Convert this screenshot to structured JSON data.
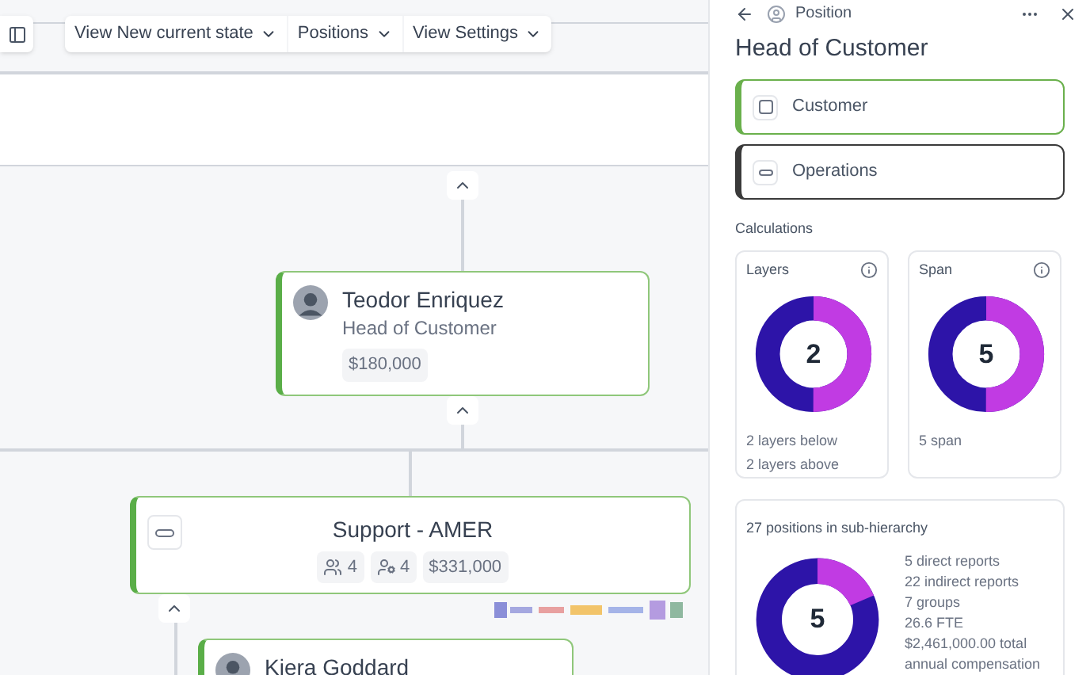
{
  "toolbar": {
    "menus": [
      {
        "label": "View New current state"
      },
      {
        "label": "Positions"
      },
      {
        "label": "View Settings"
      }
    ]
  },
  "org_chart": {
    "nodes": [
      {
        "kind": "person",
        "name": "Teodor Enriquez",
        "title": "Head of Customer",
        "salary": "$180,000"
      },
      {
        "kind": "group",
        "name": "Support - AMER",
        "stats": [
          {
            "kind": "people",
            "value": "4"
          },
          {
            "kind": "positions",
            "value": "4"
          },
          {
            "kind": "money",
            "value": "$331,000"
          }
        ]
      },
      {
        "kind": "person",
        "name": "Kiera Goddard"
      }
    ]
  },
  "panel": {
    "header": "Position",
    "title": "Head of Customer",
    "units": [
      {
        "kind": "department",
        "label": "Customer",
        "color": "#6ab04c"
      },
      {
        "kind": "team",
        "label": "Operations",
        "color": "#3a3a3a"
      }
    ],
    "section": "Calculations",
    "metrics": [
      {
        "label": "Layers",
        "value": "2",
        "level": 0.5,
        "lines": [
          "2 layers below",
          "2 layers above"
        ]
      },
      {
        "label": "Span",
        "value": "5",
        "level": 0.5,
        "lines": [
          "5 span"
        ]
      }
    ],
    "summary": {
      "label": "27 positions in sub-hierarchy",
      "value": "5",
      "level": 0.185,
      "lines": [
        "5 direct reports",
        "22 indirect reports",
        "7 groups",
        "26.6 FTE",
        "$2,461,000.00 total annual compensation"
      ]
    }
  }
}
